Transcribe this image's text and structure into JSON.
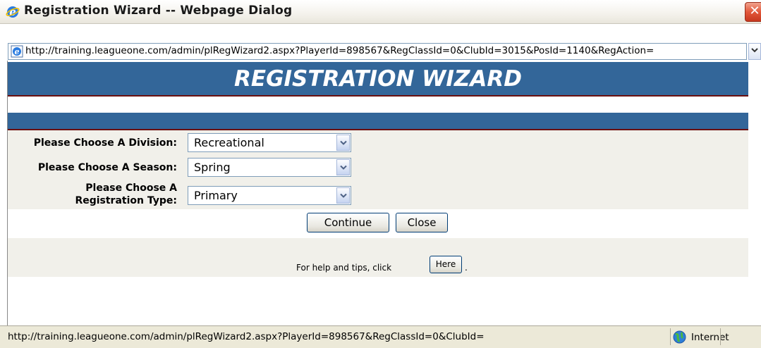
{
  "window": {
    "title": "Registration Wizard -- Webpage Dialog",
    "close_label": "✕"
  },
  "address": {
    "url": "http://training.leagueone.com/admin/plRegWizard2.aspx?PlayerId=898567&RegClassId=0&ClubId=3015&PosId=1140&RegAction="
  },
  "page": {
    "header_title": "REGISTRATION WIZARD",
    "form": {
      "division_label": "Please Choose A Division:",
      "division_value": "Recreational",
      "season_label": "Please Choose A Season:",
      "season_value": "Spring",
      "regtype_label_line1": "Please Choose A",
      "regtype_label_line2": "Registration Type:",
      "regtype_value": "Primary"
    },
    "buttons": {
      "continue": "Continue",
      "close": "Close"
    },
    "help": {
      "text": "For help and tips, click",
      "here": "Here",
      "suffix": "."
    }
  },
  "status": {
    "url": "http://training.leagueone.com/admin/plRegWizard2.aspx?PlayerId=898567&RegClassId=0&ClubId=",
    "zone": "Internet"
  },
  "colors": {
    "header_blue": "#336699",
    "header_rule": "#6b0f0f",
    "form_bg": "#f1f0ea"
  }
}
